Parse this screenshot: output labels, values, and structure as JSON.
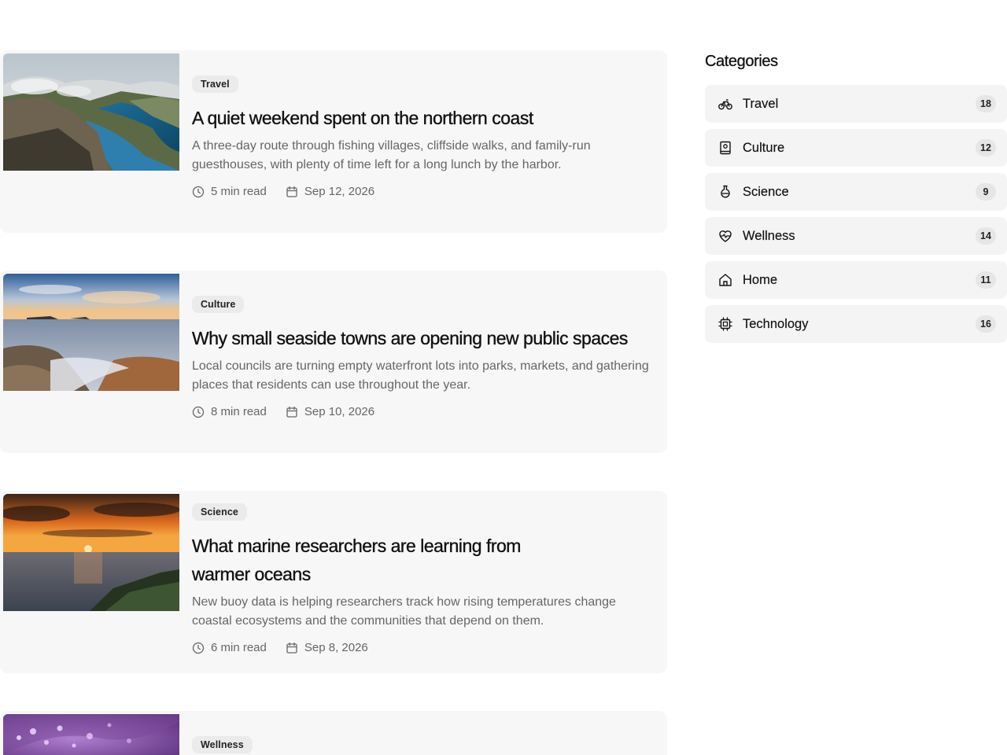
{
  "articles": [
    {
      "tag": "Travel",
      "title": "A quiet weekend spent on the northern coast",
      "description": "A three-day route through fishing villages, cliffside walks, and family-run guesthouses, with plenty of time left for a long lunch by the harbor.",
      "read_time": "5 min read",
      "date": "Sep 12, 2026",
      "image": "fjord-cliff-photo"
    },
    {
      "tag": "Culture",
      "title": "Why small seaside towns are opening new public spaces",
      "description": "Local councils are turning empty waterfront lots into parks, markets, and gathering places that residents can use throughout the year.",
      "read_time": "8 min read",
      "date": "Sep 10, 2026",
      "image": "seaside-rocks-photo"
    },
    {
      "tag": "Science",
      "title": "What marine researchers are learning from warmer oceans",
      "description": "New buoy data is helping researchers track how rising temperatures change coastal ecosystems and the communities that depend on them.",
      "read_time": "6 min read",
      "date": "Sep 8, 2026",
      "image": "ocean-sunset-photo"
    },
    {
      "tag": "Wellness",
      "image": "purple-dewdrops-photo"
    }
  ],
  "sidebar": {
    "heading": "Categories",
    "categories": [
      {
        "label": "Travel",
        "count": "18",
        "icon": "bicycle-icon"
      },
      {
        "label": "Culture",
        "count": "12",
        "icon": "book-icon"
      },
      {
        "label": "Science",
        "count": "9",
        "icon": "flask-icon"
      },
      {
        "label": "Wellness",
        "count": "14",
        "icon": "heart-pulse-icon"
      },
      {
        "label": "Home",
        "count": "11",
        "icon": "house-icon"
      },
      {
        "label": "Technology",
        "count": "16",
        "icon": "cpu-chip-icon"
      }
    ]
  },
  "icons": {
    "read_time": "clock-icon",
    "date": "calendar-icon"
  },
  "colors": {
    "card_bg": "#f7f7f7",
    "tag_bg": "#ebebeb",
    "muted_text": "#666666",
    "category_bg": "#f4f4f4"
  }
}
